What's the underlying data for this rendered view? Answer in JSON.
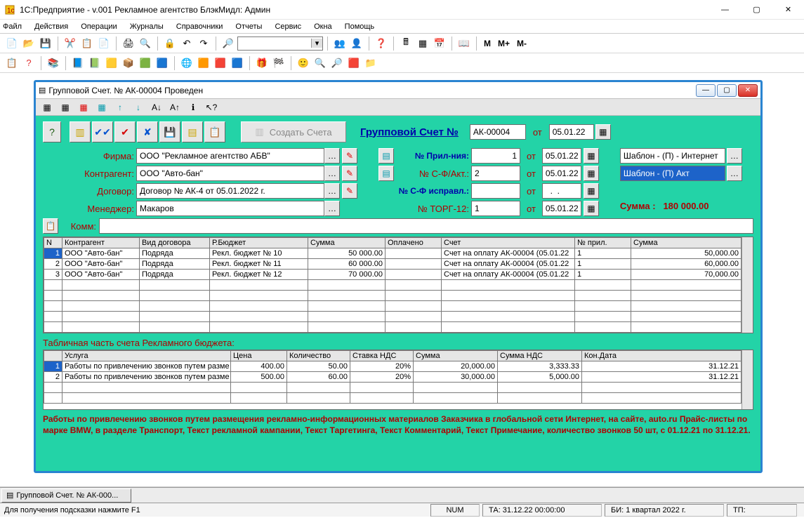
{
  "window": {
    "title": "1С:Предприятие - v.001 Рекламное агентство БлэкМидл: Админ",
    "min": "—",
    "max": "▢",
    "close": "✕"
  },
  "menu": {
    "file": "Файл",
    "actions": "Действия",
    "ops": "Операции",
    "journals": "Журналы",
    "refs": "Справочники",
    "reports": "Отчеты",
    "service": "Сервис",
    "windows": "Окна",
    "help": "Помощь"
  },
  "mtext": {
    "m": "М",
    "mplus": "М+",
    "mminus": "М-"
  },
  "mdi": {
    "title": "Групповой Счет. № АК-00004 Проведен",
    "tb_cursor_q": "?"
  },
  "hdr": {
    "create_btn": "Создать Счета",
    "doclink": "Групповой Счет  №",
    "docnum": "АК-00004",
    "ot": "от",
    "docdate": "05.01.22"
  },
  "firm": {
    "label": "Фирма:",
    "value": "ООО \"Рекламное агентство АБВ\""
  },
  "contr": {
    "label": "Контрагент:",
    "value": "ООО \"Авто-бан\""
  },
  "dogovor": {
    "label": "Договор:",
    "value": "Договор № АК-4 от 05.01.2022 г."
  },
  "manager": {
    "label": "Менеджер:",
    "value": "Макаров"
  },
  "komm": {
    "label": "Комм:",
    "value": ""
  },
  "right": {
    "pril": {
      "label": "№ Прил-ния:",
      "value": "1",
      "date": "05.01.22"
    },
    "sfakt": {
      "label": "№ С-Ф/Акт.:",
      "value": "2",
      "date": "05.01.22"
    },
    "sfisp": {
      "label": "№ С-Ф исправл.:",
      "value": "",
      "date": "  .  .  "
    },
    "torg": {
      "label": "№ ТОРГ-12:",
      "value": "1",
      "date": "05.01.22"
    },
    "tpl1": "Шаблон - (П) - Интернет",
    "tpl2": "Шаблон - (П) Акт",
    "sum_lbl": "Сумма :",
    "sum_val": "180 000.00"
  },
  "tbl1": {
    "cols": {
      "n": "N",
      "k": "Контрагент",
      "v": "Вид договора",
      "r": "Р.Бюджет",
      "s": "Сумма",
      "o": "Оплачено",
      "sch": "Счет",
      "np": "№ прил.",
      "s2": "Сумма"
    },
    "rows": [
      {
        "n": "1",
        "k": "ООО \"Авто-бан\"",
        "v": "Подряда",
        "r": "Рекл. бюджет № 10",
        "s": "50 000.00",
        "o": "",
        "sch": "Счет на оплату АК-00004 (05.01.22",
        "np": "1",
        "s2": "50,000.00"
      },
      {
        "n": "2",
        "k": "ООО \"Авто-бан\"",
        "v": "Подряда",
        "r": "Рекл. бюджет № 11",
        "s": "60 000.00",
        "o": "",
        "sch": "Счет на оплату АК-00004 (05.01.22",
        "np": "1",
        "s2": "60,000.00"
      },
      {
        "n": "3",
        "k": "ООО \"Авто-бан\"",
        "v": "Подряда",
        "r": "Рекл. бюджет № 12",
        "s": "70 000.00",
        "o": "",
        "sch": "Счет на оплату АК-00004 (05.01.22",
        "np": "1",
        "s2": "70,000.00"
      }
    ]
  },
  "section2": "Табличная часть счета Рекламного бюджета:",
  "tbl2": {
    "cols": {
      "n": "",
      "u": "Услуга",
      "c": "Цена",
      "q": "Количество",
      "nds": "Ставка НДС",
      "s": "Сумма",
      "snds": "Сумма НДС",
      "kd": "Кон.Дата"
    },
    "rows": [
      {
        "n": "1",
        "u": "Работы по привлечению звонков путем разме",
        "c": "400.00",
        "q": "50.00",
        "nds": "20%",
        "s": "20,000.00",
        "snds": "3,333.33",
        "kd": "31.12.21"
      },
      {
        "n": "2",
        "u": "Работы по привлечению звонков путем разме",
        "c": "500.00",
        "q": "60.00",
        "nds": "20%",
        "s": "30,000.00",
        "snds": "5,000.00",
        "kd": "31.12.21"
      }
    ]
  },
  "footnote": "Работы по привлечению звонков путем размещения рекламно-информационных материалов Заказчика в глобальной сети Интернет, на сайте, auto.ru Прайс-листы по марке BMW, в разделе Транспорт, Текст рекламной кампании, Текст Таргетинга, Текст Комментарий, Текст Примечание, количество звонков 50 шт, с 01.12.21 по 31.12.21.",
  "taskbar_item": "Групповой Счет. № АК-000...",
  "status": {
    "hint": "Для получения подсказки нажмите F1",
    "num": "NUM",
    "ta": "ТА: 31.12.22  00:00:00",
    "bi": "БИ: 1 квартал 2022 г.",
    "tp": "ТП:"
  }
}
